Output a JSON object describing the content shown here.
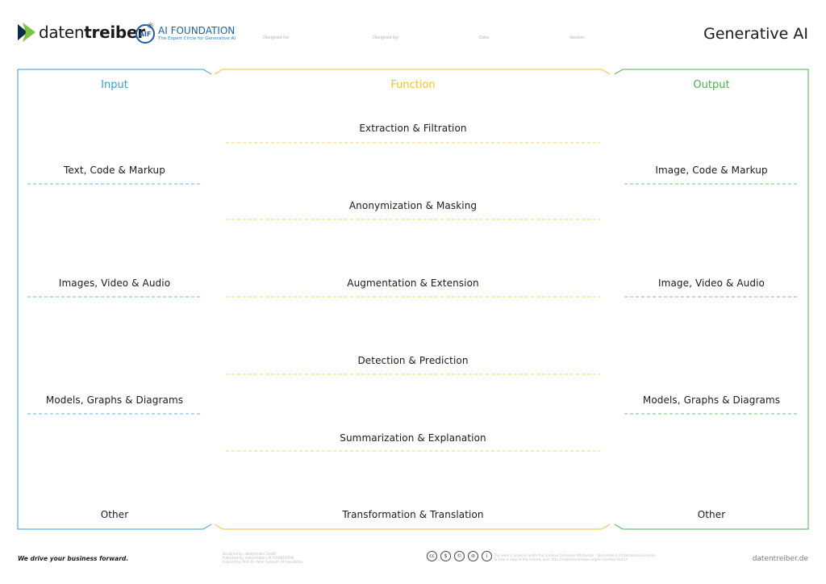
{
  "header": {
    "brand_light": "daten",
    "brand_bold": "treiber",
    "brand_reg": "®",
    "aif_badge": "AIF",
    "aif_title": "AI FOUNDATION",
    "aif_subtitle": "The Expert Circle for Generative AI",
    "meta": [
      "Designed for:",
      "Designed by:",
      "Date:",
      "Version:"
    ],
    "title": "Generative AI"
  },
  "columns": {
    "input": {
      "title": "Input",
      "color": "#3a9ad9"
    },
    "function": {
      "title": "Function",
      "color": "#f2c12e"
    },
    "output": {
      "title": "Output",
      "color": "#4caf50"
    }
  },
  "input_items": [
    "Text, Code & Markup",
    "Images, Video & Audio",
    "Models, Graphs & Diagrams",
    "Other"
  ],
  "function_items": [
    "Extraction & Filtration",
    "Anonymization & Masking",
    "Augmentation & Extension",
    "Detection & Prediction",
    "Summarization & Explanation",
    "Transformation & Translation"
  ],
  "output_items": [
    "Image, Code & Markup",
    "Image, Video & Audio",
    "Models, Graphs & Diagrams",
    "Other"
  ],
  "footer": {
    "tagline": "We drive your business forward.",
    "credit_lines": [
      "Designed by: datentreiber GmbH",
      "Published by: datentreiber / AI FOUNDATION",
      "Inspired by: Prof. Dr. Peter Gentsch, AI Foundation"
    ],
    "license_lines": [
      "This work is licensed under the Creative Commons Attribution - ShareAlike 4.0 International License.",
      "To view a copy of this license, visit: http://creativecommons.org/licenses/by-sa/4.0/"
    ],
    "cc_icons": [
      "cc",
      "$",
      "©",
      "⊜",
      "i"
    ],
    "site": "datentreiber.de"
  }
}
